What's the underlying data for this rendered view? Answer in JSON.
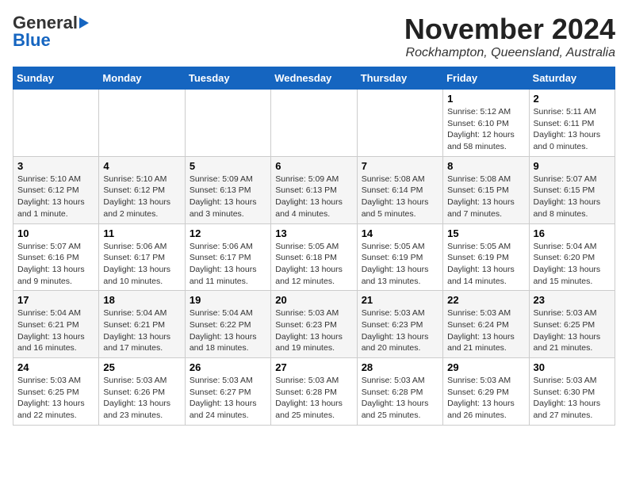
{
  "header": {
    "logo_general": "General",
    "logo_blue": "Blue",
    "title": "November 2024",
    "location": "Rockhampton, Queensland, Australia"
  },
  "calendar": {
    "days_of_week": [
      "Sunday",
      "Monday",
      "Tuesday",
      "Wednesday",
      "Thursday",
      "Friday",
      "Saturday"
    ],
    "weeks": [
      [
        {
          "day": "",
          "info": ""
        },
        {
          "day": "",
          "info": ""
        },
        {
          "day": "",
          "info": ""
        },
        {
          "day": "",
          "info": ""
        },
        {
          "day": "",
          "info": ""
        },
        {
          "day": "1",
          "info": "Sunrise: 5:12 AM\nSunset: 6:10 PM\nDaylight: 12 hours\nand 58 minutes."
        },
        {
          "day": "2",
          "info": "Sunrise: 5:11 AM\nSunset: 6:11 PM\nDaylight: 13 hours\nand 0 minutes."
        }
      ],
      [
        {
          "day": "3",
          "info": "Sunrise: 5:10 AM\nSunset: 6:12 PM\nDaylight: 13 hours\nand 1 minute."
        },
        {
          "day": "4",
          "info": "Sunrise: 5:10 AM\nSunset: 6:12 PM\nDaylight: 13 hours\nand 2 minutes."
        },
        {
          "day": "5",
          "info": "Sunrise: 5:09 AM\nSunset: 6:13 PM\nDaylight: 13 hours\nand 3 minutes."
        },
        {
          "day": "6",
          "info": "Sunrise: 5:09 AM\nSunset: 6:13 PM\nDaylight: 13 hours\nand 4 minutes."
        },
        {
          "day": "7",
          "info": "Sunrise: 5:08 AM\nSunset: 6:14 PM\nDaylight: 13 hours\nand 5 minutes."
        },
        {
          "day": "8",
          "info": "Sunrise: 5:08 AM\nSunset: 6:15 PM\nDaylight: 13 hours\nand 7 minutes."
        },
        {
          "day": "9",
          "info": "Sunrise: 5:07 AM\nSunset: 6:15 PM\nDaylight: 13 hours\nand 8 minutes."
        }
      ],
      [
        {
          "day": "10",
          "info": "Sunrise: 5:07 AM\nSunset: 6:16 PM\nDaylight: 13 hours\nand 9 minutes."
        },
        {
          "day": "11",
          "info": "Sunrise: 5:06 AM\nSunset: 6:17 PM\nDaylight: 13 hours\nand 10 minutes."
        },
        {
          "day": "12",
          "info": "Sunrise: 5:06 AM\nSunset: 6:17 PM\nDaylight: 13 hours\nand 11 minutes."
        },
        {
          "day": "13",
          "info": "Sunrise: 5:05 AM\nSunset: 6:18 PM\nDaylight: 13 hours\nand 12 minutes."
        },
        {
          "day": "14",
          "info": "Sunrise: 5:05 AM\nSunset: 6:19 PM\nDaylight: 13 hours\nand 13 minutes."
        },
        {
          "day": "15",
          "info": "Sunrise: 5:05 AM\nSunset: 6:19 PM\nDaylight: 13 hours\nand 14 minutes."
        },
        {
          "day": "16",
          "info": "Sunrise: 5:04 AM\nSunset: 6:20 PM\nDaylight: 13 hours\nand 15 minutes."
        }
      ],
      [
        {
          "day": "17",
          "info": "Sunrise: 5:04 AM\nSunset: 6:21 PM\nDaylight: 13 hours\nand 16 minutes."
        },
        {
          "day": "18",
          "info": "Sunrise: 5:04 AM\nSunset: 6:21 PM\nDaylight: 13 hours\nand 17 minutes."
        },
        {
          "day": "19",
          "info": "Sunrise: 5:04 AM\nSunset: 6:22 PM\nDaylight: 13 hours\nand 18 minutes."
        },
        {
          "day": "20",
          "info": "Sunrise: 5:03 AM\nSunset: 6:23 PM\nDaylight: 13 hours\nand 19 minutes."
        },
        {
          "day": "21",
          "info": "Sunrise: 5:03 AM\nSunset: 6:23 PM\nDaylight: 13 hours\nand 20 minutes."
        },
        {
          "day": "22",
          "info": "Sunrise: 5:03 AM\nSunset: 6:24 PM\nDaylight: 13 hours\nand 21 minutes."
        },
        {
          "day": "23",
          "info": "Sunrise: 5:03 AM\nSunset: 6:25 PM\nDaylight: 13 hours\nand 21 minutes."
        }
      ],
      [
        {
          "day": "24",
          "info": "Sunrise: 5:03 AM\nSunset: 6:25 PM\nDaylight: 13 hours\nand 22 minutes."
        },
        {
          "day": "25",
          "info": "Sunrise: 5:03 AM\nSunset: 6:26 PM\nDaylight: 13 hours\nand 23 minutes."
        },
        {
          "day": "26",
          "info": "Sunrise: 5:03 AM\nSunset: 6:27 PM\nDaylight: 13 hours\nand 24 minutes."
        },
        {
          "day": "27",
          "info": "Sunrise: 5:03 AM\nSunset: 6:28 PM\nDaylight: 13 hours\nand 25 minutes."
        },
        {
          "day": "28",
          "info": "Sunrise: 5:03 AM\nSunset: 6:28 PM\nDaylight: 13 hours\nand 25 minutes."
        },
        {
          "day": "29",
          "info": "Sunrise: 5:03 AM\nSunset: 6:29 PM\nDaylight: 13 hours\nand 26 minutes."
        },
        {
          "day": "30",
          "info": "Sunrise: 5:03 AM\nSunset: 6:30 PM\nDaylight: 13 hours\nand 27 minutes."
        }
      ]
    ]
  }
}
